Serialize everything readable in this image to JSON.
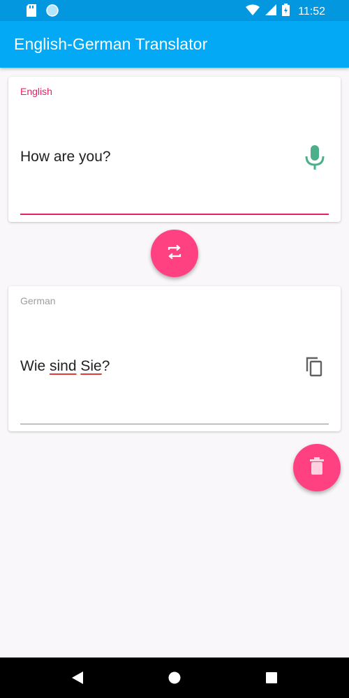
{
  "status_bar": {
    "time": "11:52",
    "icons": [
      "sd-card-icon",
      "sync-icon",
      "wifi-icon",
      "signal-icon",
      "battery-icon"
    ]
  },
  "app_bar": {
    "title": "English-German Translator",
    "color": "#03a9f4"
  },
  "source_card": {
    "label": "English",
    "text": "How are you?",
    "action_icon": "microphone-icon",
    "accent": "#e91e63",
    "icon_color": "#4caf8a"
  },
  "swap_button": {
    "icon": "swap-icon",
    "color": "#ff4081"
  },
  "target_card": {
    "label": "German",
    "text_parts": [
      "Wie ",
      "sind",
      " ",
      "Sie",
      "?"
    ],
    "action_icon": "copy-icon"
  },
  "clear_button": {
    "icon": "delete-icon",
    "color": "#ff4081"
  },
  "nav_bar": {
    "buttons": [
      "back-icon",
      "home-icon",
      "recents-icon"
    ]
  }
}
